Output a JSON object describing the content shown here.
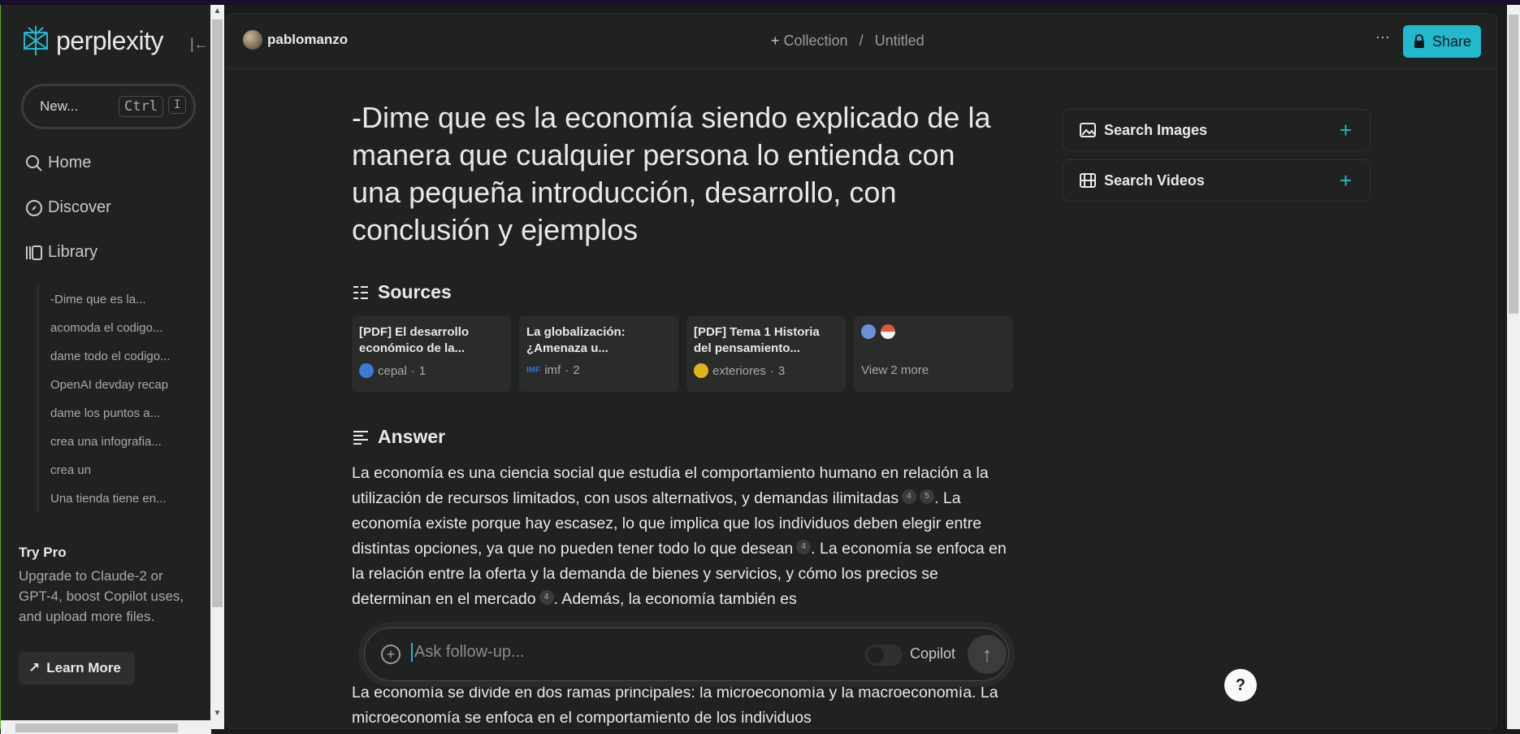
{
  "sidebar": {
    "logo": "perplexity",
    "new_label": "New...",
    "kbd_ctrl": "Ctrl",
    "kbd_i": "I",
    "nav": [
      {
        "label": "Home",
        "icon": "search-icon"
      },
      {
        "label": "Discover",
        "icon": "compass-icon"
      },
      {
        "label": "Library",
        "icon": "library-icon"
      }
    ],
    "library_items": [
      "-Dime que es la...",
      "acomoda el codigo...",
      "dame todo el codigo...",
      "OpenAI devday recap",
      "dame los puntos a...",
      "crea una infografia...",
      "crea un",
      "Una tienda tiene en..."
    ],
    "trypro_title": "Try Pro",
    "trypro_desc": "Upgrade to Claude-2 or GPT-4, boost Copilot uses, and upload more files.",
    "learn_more": "Learn More"
  },
  "header": {
    "username": "pablomanzo",
    "collection_label": "Collection",
    "separator": "/",
    "title": "Untitled",
    "share_label": "Share"
  },
  "question": "-Dime que es la economía siendo explicado de la manera que cualquier persona lo entienda con una pequeña introducción, desarrollo, con conclusión y ejemplos",
  "sources_title": "Sources",
  "sources": [
    {
      "title": "[PDF] El desarrollo económico de la...",
      "site": "cepal",
      "num": "1"
    },
    {
      "title": "La globalización: ¿Amenaza u...",
      "site": "imf",
      "num": "2"
    },
    {
      "title": "[PDF] Tema 1 Historia del pensamiento...",
      "site": "exteriores",
      "num": "3"
    }
  ],
  "view_more": "View 2 more",
  "answer_title": "Answer",
  "answer": {
    "p1a": "La economía es una ciencia social que estudia el comportamiento humano en relación a la utilización de recursos limitados, con usos alternativos, y demandas ilimitadas",
    "c1": "4",
    "c2": "5",
    "p1b": ". La economía existe porque hay escasez, lo que implica que los individuos deben elegir entre distintas opciones, ya que no pueden tener todo lo que desean",
    "c3": "4",
    "p1c": ". La economía se enfoca en la relación entre la oferta y la demanda de bienes y servicios, y cómo los precios se determinan en el mercado",
    "c4": "4",
    "p1d": ". Además, la economía también es",
    "p2": "La economía se divide en dos ramas principales: la microeconomía y la macroeconomía. La microeconomía se enfoca en el comportamiento de los individuos"
  },
  "followup": {
    "placeholder": "Ask follow-up...",
    "copilot": "Copilot"
  },
  "media": {
    "images": "Search Images",
    "videos": "Search Videos"
  },
  "help": "?",
  "colors": {
    "accent": "#22b8cd",
    "bg": "#202222"
  }
}
